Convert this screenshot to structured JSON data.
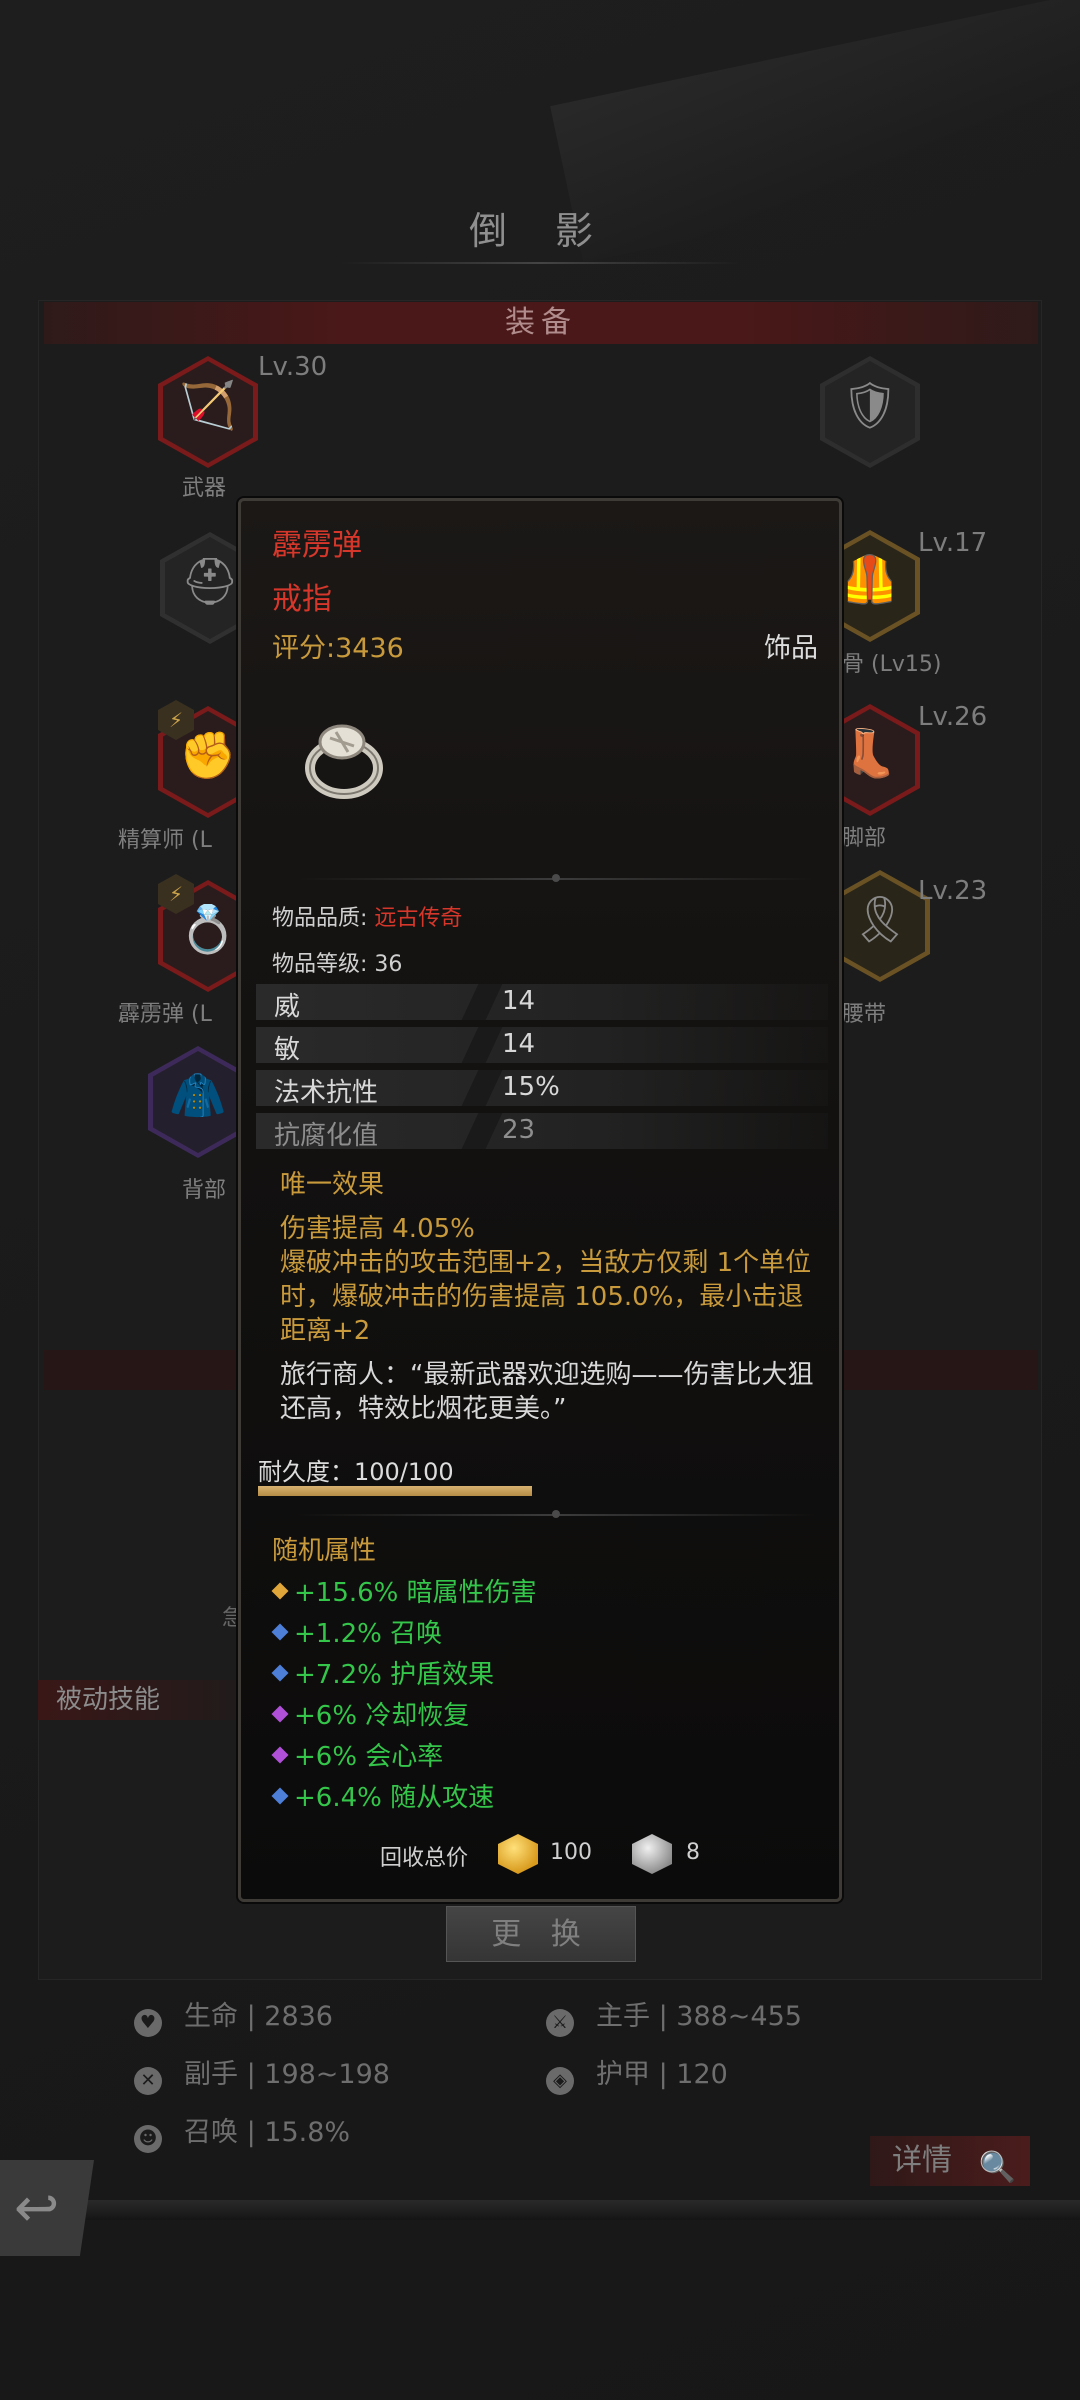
{
  "screen": {
    "title": "倒 影",
    "section_header": "装备"
  },
  "slots": {
    "weapon": {
      "label": "武器",
      "level": "Lv.30"
    },
    "shield": {
      "label": ""
    },
    "helmet": {
      "label": ""
    },
    "chest": {
      "label_partial": "骨 (Lv15)",
      "level": "Lv.17"
    },
    "accountant": {
      "label_partial": "精算师 (L",
      "badge": "⚡"
    },
    "feet": {
      "label": "脚部",
      "level": "Lv.26"
    },
    "ring": {
      "label_partial": "霹雳弹 (L",
      "badge": "⚡"
    },
    "belt": {
      "label": "腰带",
      "level": "Lv.23"
    },
    "back": {
      "label": "背部"
    }
  },
  "tooltip": {
    "name": "霹雳弹",
    "type": "戒指",
    "score": "评分:3436",
    "category": "饰品",
    "item_icon": "ring-icon",
    "quality_label": "物品品质: ",
    "quality_value": "远古传奇",
    "level_label": "物品等级: 36",
    "attributes": [
      {
        "k": "威",
        "v": "14"
      },
      {
        "k": "敏",
        "v": "14"
      },
      {
        "k": "法术抗性",
        "v": "15%"
      },
      {
        "k": "抗腐化值",
        "v": "23"
      }
    ],
    "unique_title": "唯一效果",
    "unique_body": "伤害提高 4.05%\n爆破冲击的攻击范围+2，当敌方仅剩 1个单位时，爆破冲击的伤害提高 105.0%，最小击退距离+2",
    "flavor": "旅行商人：“最新武器欢迎选购——伤害比大狙还高，特效比烟花更美。”",
    "durability_label": "耐久度：100/100",
    "durability_fraction": 1.0,
    "random_title": "随机属性",
    "random_stats": [
      {
        "text": "+15.6% 暗属性伤害",
        "gem": "#e0a63a"
      },
      {
        "text": "+1.2% 召唤",
        "gem": "#4d7fd8"
      },
      {
        "text": "+7.2% 护盾效果",
        "gem": "#4d7fd8"
      },
      {
        "text": "+6% 冷却恢复",
        "gem": "#b050d8"
      },
      {
        "text": "+6% 会心率",
        "gem": "#b050d8"
      },
      {
        "text": "+6.4% 随从攻速",
        "gem": "#4d7fd8"
      }
    ],
    "recycle_label": "回收总价",
    "coin_value": "100",
    "ore_value": "8"
  },
  "partials": {
    "edge_char": "急"
  },
  "passive_label": "被动技能",
  "swap_button": "更 换",
  "stats": {
    "life": "生命 | 2836",
    "mainhand": "主手 | 388~455",
    "offhand": "副手 | 198~198",
    "armor": "护甲 | 120",
    "summon": "召唤 | 15.8%"
  },
  "details_button": "详情",
  "colors": {
    "legendary_red": "#d6372a",
    "gold": "#c89a3c",
    "green": "#34c64a"
  }
}
